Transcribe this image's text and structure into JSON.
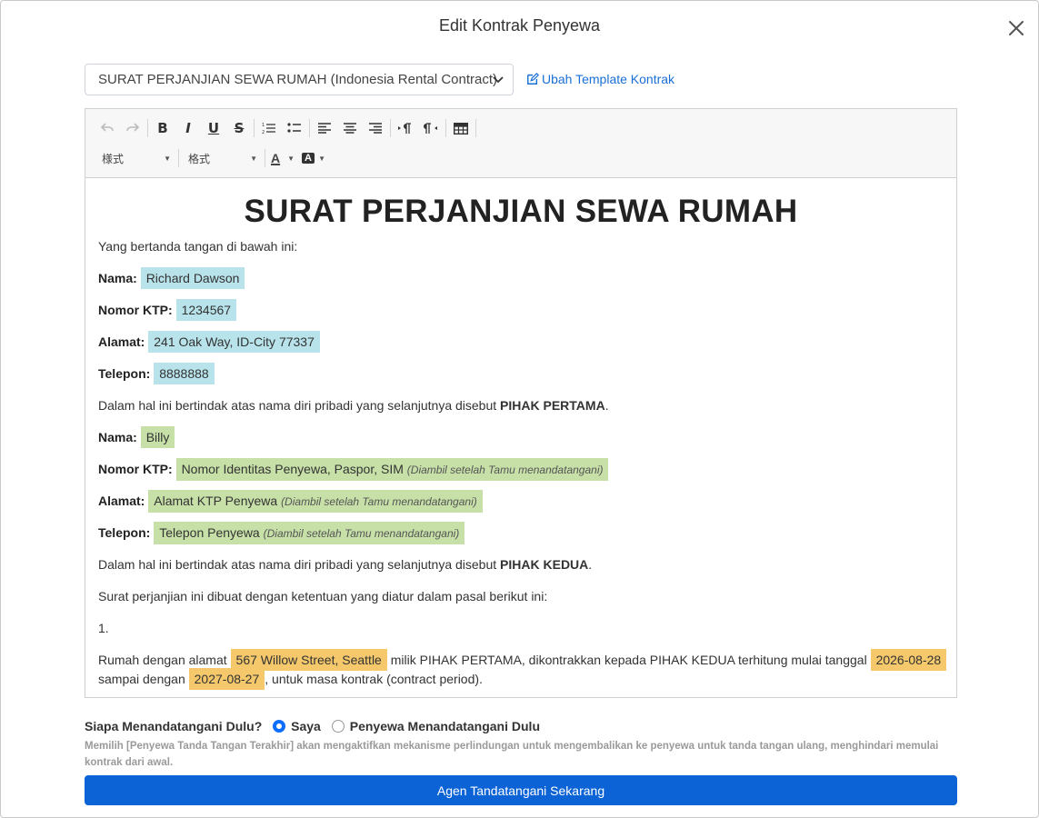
{
  "modal": {
    "title": "Edit Kontrak Penyewa"
  },
  "template": {
    "selected": "SURAT PERJANJIAN SEWA RUMAH (Indonesia Rental Contract)",
    "edit_link": "Ubah Template Kontrak"
  },
  "toolbar": {
    "bold": "B",
    "italic": "I",
    "underline": "U",
    "strike": "S",
    "style_dropdown": "様式",
    "format_dropdown": "格式",
    "font_color": "A",
    "bg_color": "A"
  },
  "document": {
    "title": "SURAT PERJANJIAN SEWA RUMAH",
    "intro": "Yang bertanda tangan di bawah ini:",
    "labels": {
      "name": "Nama:",
      "ktp": "Nomor KTP:",
      "address": "Alamat:",
      "phone": "Telepon:"
    },
    "party1": {
      "name": "Richard Dawson",
      "ktp": "1234567",
      "address": "241 Oak Way, ID-City 77337",
      "phone": "8888888"
    },
    "party1_statement": "Dalam hal ini bertindak atas nama diri pribadi yang selanjutnya disebut ",
    "party1_label": "PIHAK PERTAMA",
    "party2": {
      "name": "Billy",
      "ktp": "Nomor Identitas Penyewa, Paspor, SIM",
      "address": "Alamat KTP Penyewa",
      "phone": "Telepon Penyewa",
      "pending_note": "(Diambil setelah Tamu menandatangani)"
    },
    "party2_statement": "Dalam hal ini bertindak atas nama diri pribadi yang selanjutnya disebut ",
    "party2_label": "PIHAK KEDUA",
    "terms_intro": "Surat perjanjian ini dibuat dengan ketentuan yang diatur dalam pasal berikut ini:",
    "clause_number": "1.",
    "clause": {
      "part1": "Rumah dengan alamat ",
      "address": "567 Willow Street, Seattle",
      "part2": " milik PIHAK PERTAMA, dikontrakkan kepada PIHAK KEDUA terhitung mulai tanggal ",
      "start_date": "2026-08-28",
      "part3": "sampai dengan ",
      "end_date": "2027-08-27",
      "part4": ", untuk masa kontrak (contract period)."
    },
    "punct": "."
  },
  "signing": {
    "question": "Siapa Menandatangani Dulu?",
    "option_me": "Saya",
    "option_tenant": "Penyewa Menandatangani Dulu",
    "selected": "Saya",
    "help": "Memilih [Penyewa Tanda Tangan Terakhir] akan mengaktifkan mekanisme perlindungan untuk mengembalikan ke penyewa untuk tanda tangan ulang, menghindari memulai kontrak dari awal.",
    "button": "Agen Tandatangani Sekarang"
  },
  "colors": {
    "primary": "#0b63d6",
    "highlight_party1": "#b8e3ea",
    "highlight_party2": "#c7e0a8",
    "highlight_clause": "#f5c96b"
  }
}
